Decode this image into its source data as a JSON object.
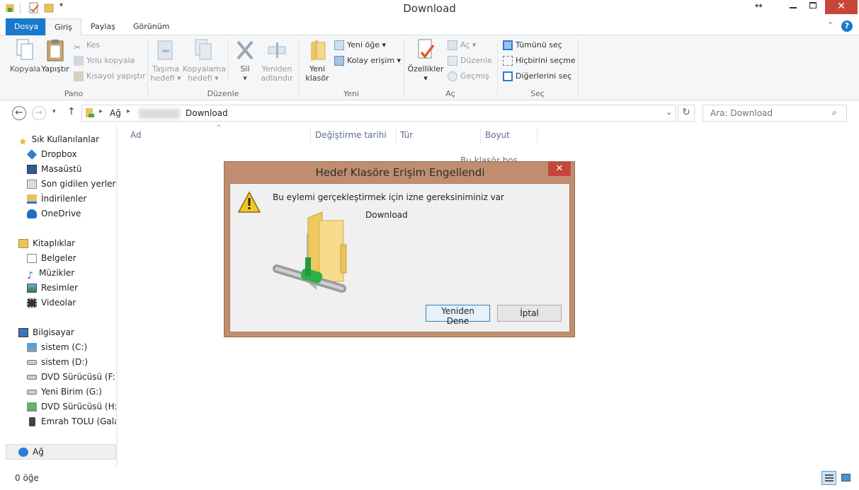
{
  "window": {
    "title": "Download"
  },
  "ribbon_tabs": [
    {
      "label": "Dosya"
    },
    {
      "label": "Giriş"
    },
    {
      "label": "Paylaş"
    },
    {
      "label": "Görünüm"
    }
  ],
  "ribbon": {
    "pano": {
      "label": "Pano",
      "kopyala": "Kopyala",
      "yapistir": "Yapıştır",
      "kes": "Kes",
      "yolu_kopyala": "Yolu kopyala",
      "kisayol_yapistir": "Kısayol yapıştır"
    },
    "duzenle": {
      "label": "Düzenle",
      "tasima_1": "Taşıma",
      "tasima_2": "hedefi",
      "kopyalama_1": "Kopyalama",
      "kopyalama_2": "hedefi",
      "sil": "Sil",
      "yeniden_1": "Yeniden",
      "yeniden_2": "adlandır"
    },
    "yeni": {
      "label": "Yeni",
      "klasor_1": "Yeni",
      "klasor_2": "klasör",
      "yeni_oge": "Yeni öğe",
      "kolay_erisim": "Kolay erişim"
    },
    "ac": {
      "label": "Aç",
      "ozellikler": "Özellikler",
      "ac": "Aç",
      "duzenle": "Düzenle",
      "gecmis": "Geçmiş"
    },
    "sec": {
      "label": "Seç",
      "tumunu_sec": "Tümünü seç",
      "hicbirini_secme": "Hiçbirini seçme",
      "digerlerini_sec": "Diğerlerini seç"
    }
  },
  "address": {
    "crumb_root": "Ağ",
    "crumb_folder": "Download"
  },
  "search": {
    "placeholder": "Ara: Download"
  },
  "nav": {
    "favorites": {
      "label": "Sık Kullanılanlar",
      "items": [
        "Dropbox",
        "Masaüstü",
        "Son gidilen yerler",
        "İndirilenler",
        "OneDrive"
      ]
    },
    "libraries": {
      "label": "Kitaplıklar",
      "items": [
        "Belgeler",
        "Müzikler",
        "Resimler",
        "Videolar"
      ]
    },
    "computer": {
      "label": "Bilgisayar",
      "items": [
        "sistem (C:)",
        "sistem (D:)",
        "DVD Sürücüsü (F:) G",
        "Yeni Birim (G:)",
        "DVD Sürücüsü (H:) II",
        "Emrah TOLU (Galaxy"
      ]
    },
    "network": {
      "label": "Ağ"
    }
  },
  "columns": [
    "Ad",
    "Değiştirme tarihi",
    "Tür",
    "Boyut"
  ],
  "content": {
    "empty_text": "Bu klasör boş."
  },
  "status": {
    "items": "0 öğe"
  },
  "dialog": {
    "title": "Hedef Klasöre Erişim Engellendi",
    "message": "Bu eylemi gerçekleştirmek için izne gereksiniminiz var",
    "folder_name": "Download",
    "retry_button": "Yeniden Dene",
    "cancel_button": "İptal"
  },
  "colors": {
    "file_tab": "#1979ca",
    "dialog_frame": "#c08e6f",
    "close_red": "#c7463b",
    "ribbon_bg": "#f5f6f7"
  }
}
